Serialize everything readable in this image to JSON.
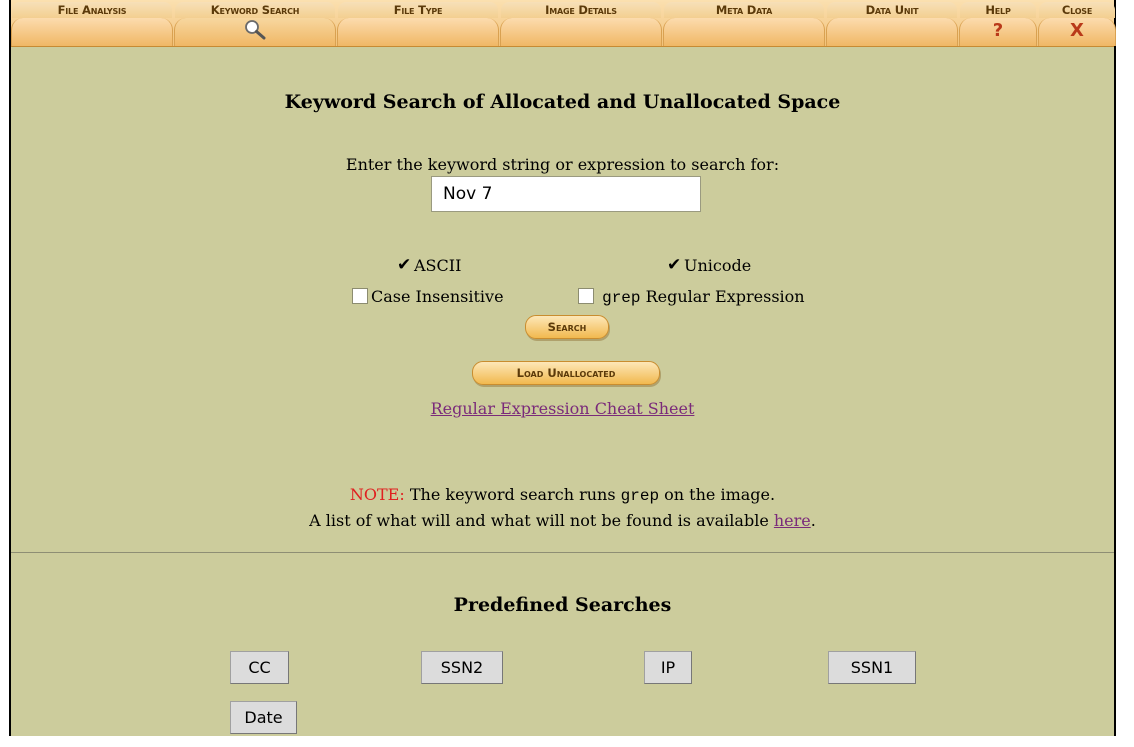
{
  "toolbar": {
    "tabs": [
      {
        "label": "File Analysis"
      },
      {
        "label": "Keyword Search"
      },
      {
        "label": "File Type"
      },
      {
        "label": "Image Details"
      },
      {
        "label": "Meta Data"
      },
      {
        "label": "Data Unit"
      },
      {
        "label": "Help",
        "glyph": "?"
      },
      {
        "label": "Close",
        "glyph": "X"
      }
    ],
    "active_tab": "Keyword Search",
    "active_icon": "magnifier-icon"
  },
  "main": {
    "title": "Keyword Search of Allocated and Unallocated Space",
    "prompt": "Enter the keyword string or expression to search for:",
    "search_value": "Nov 7",
    "options": {
      "ascii_label": "ASCII",
      "ascii_checked": true,
      "unicode_label": "Unicode",
      "unicode_checked": true,
      "case_label": "Case Insensitive",
      "case_checked": false,
      "grep_mono": "grep",
      "grep_label": " Regular Expression",
      "grep_checked": false
    },
    "search_button": "Search",
    "load_button": "Load Unallocated",
    "cheat_sheet_link": "Regular Expression Cheat Sheet",
    "note": {
      "label": "NOTE:",
      "text_before": " The keyword search runs ",
      "mono": "grep",
      "text_after": " on the image.",
      "line2_before": "A list of what will and what will not be found is available ",
      "line2_link": "here",
      "line2_after": "."
    }
  },
  "predefined": {
    "title": "Predefined Searches",
    "buttons": [
      "CC",
      "SSN2",
      "IP",
      "SSN1",
      "Date"
    ]
  },
  "colors": {
    "panel_bg": "#cccc9c",
    "toolbar_orange": "#f2c27a",
    "note_red": "#e02020",
    "link_purple": "#7a2a7a"
  }
}
